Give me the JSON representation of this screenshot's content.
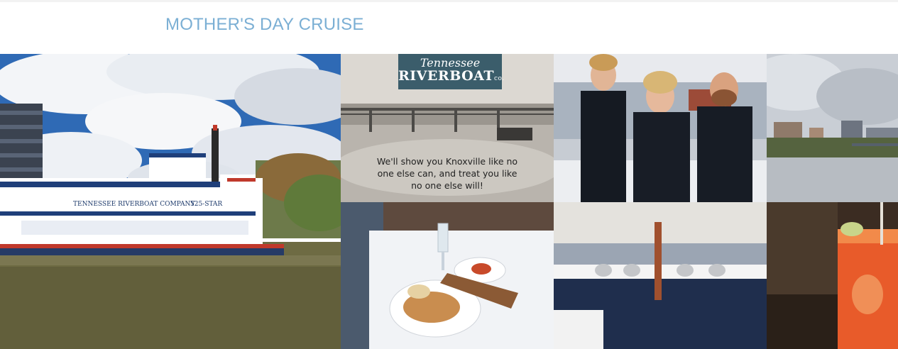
{
  "page": {
    "title": "MOTHER'S DAY CRUISE"
  },
  "colors": {
    "title": "#7bafd4",
    "background": "#ffffff"
  },
  "gallery": {
    "riverboat": {
      "sign_left": "TENNESSEE RIVERBOAT COMPANY",
      "sign_right": "525-STAR"
    },
    "promo": {
      "logo_line1": "Tennessee",
      "logo_line2": "RIVERBOAT",
      "logo_suffix": "co.",
      "caption_line1": "We'll show you Knoxville like no",
      "caption_line2": "one else can, and treat you like",
      "caption_line3": "no one else will!"
    }
  }
}
